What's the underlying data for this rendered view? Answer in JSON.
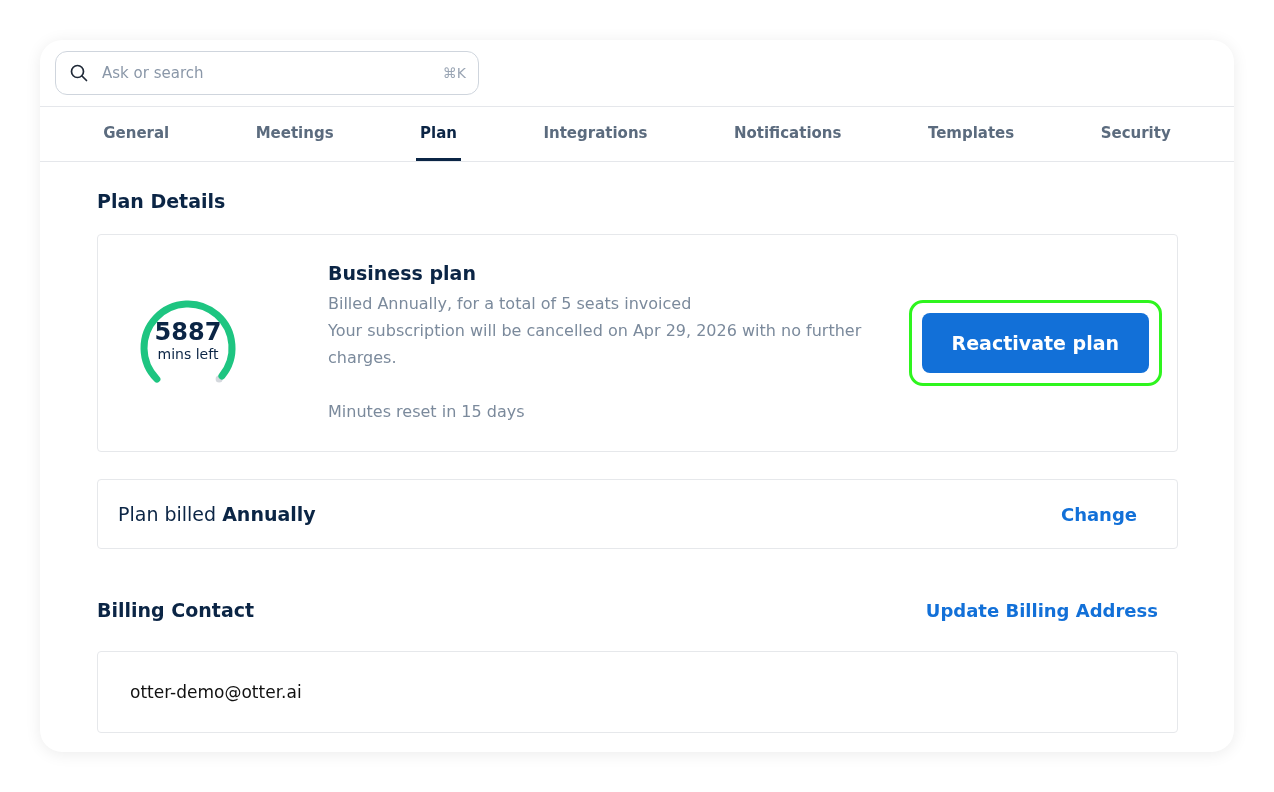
{
  "search": {
    "placeholder": "Ask or search",
    "shortcut": "⌘K"
  },
  "tabs": [
    {
      "label": "General",
      "selected": false
    },
    {
      "label": "Meetings",
      "selected": false
    },
    {
      "label": "Plan",
      "selected": true
    },
    {
      "label": "Integrations",
      "selected": false
    },
    {
      "label": "Notifications",
      "selected": false
    },
    {
      "label": "Templates",
      "selected": false
    },
    {
      "label": "Security",
      "selected": false
    }
  ],
  "plan_details": {
    "heading": "Plan Details",
    "gauge": {
      "value": "5887",
      "unit": "mins left"
    },
    "plan_name": "Business plan",
    "lines": [
      "Billed Annually, for a total of 5 seats invoiced",
      "Your subscription will be cancelled on Apr 29, 2026 with no further charges."
    ],
    "reset_note": "Minutes reset in 15 days",
    "button": {
      "label": "Reactivate plan",
      "highlighted": true
    }
  },
  "billing_row": {
    "text": "Plan billed **Annually**",
    "link": "Change"
  },
  "billing_contact": {
    "heading": "Billing Contact",
    "link": "Update Billing Address",
    "email": "otter-demo@otter.ai"
  }
}
